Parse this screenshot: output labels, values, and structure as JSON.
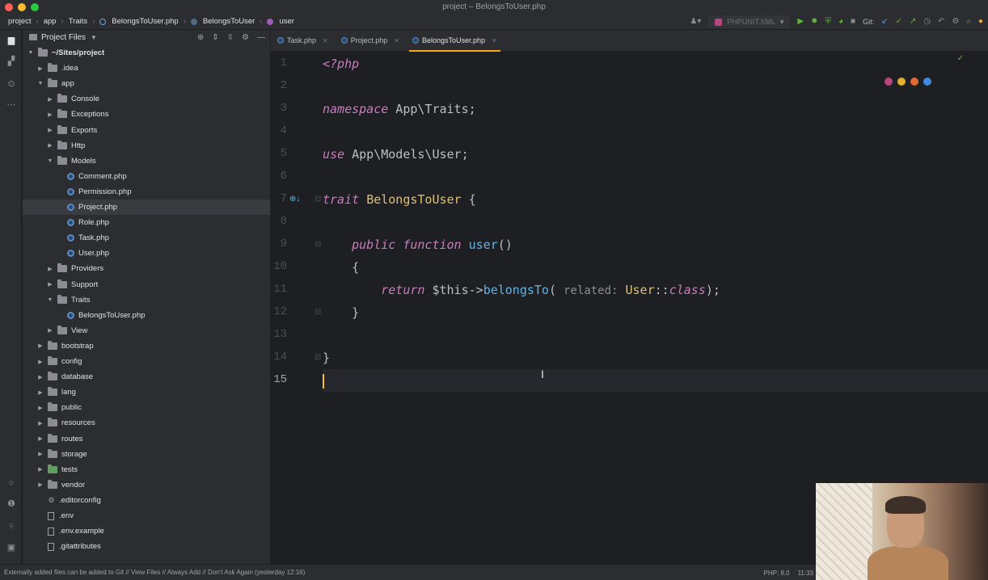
{
  "window": {
    "title": "project – BelongsToUser.php"
  },
  "breadcrumb": {
    "items": [
      "project",
      "app",
      "Traits",
      "BelongsToUser.php",
      "BelongsToUser",
      "user"
    ]
  },
  "toolbar": {
    "run_config": "PHPUNIT.XML",
    "git_label": "Git:"
  },
  "project_panel": {
    "title": "Project Files",
    "tree": [
      {
        "label": "~/Sites/project",
        "type": "folder",
        "depth": 0,
        "expanded": true
      },
      {
        "label": ".idea",
        "type": "folder",
        "depth": 1,
        "expanded": false
      },
      {
        "label": "app",
        "type": "folder",
        "depth": 1,
        "expanded": true
      },
      {
        "label": "Console",
        "type": "folder",
        "depth": 2,
        "expanded": false
      },
      {
        "label": "Exceptions",
        "type": "folder",
        "depth": 2,
        "expanded": false
      },
      {
        "label": "Exports",
        "type": "folder",
        "depth": 2,
        "expanded": false
      },
      {
        "label": "Http",
        "type": "folder",
        "depth": 2,
        "expanded": false
      },
      {
        "label": "Models",
        "type": "folder",
        "depth": 2,
        "expanded": true
      },
      {
        "label": "Comment.php",
        "type": "php",
        "depth": 3
      },
      {
        "label": "Permission.php",
        "type": "php",
        "depth": 3
      },
      {
        "label": "Project.php",
        "type": "php",
        "depth": 3,
        "selected": true
      },
      {
        "label": "Role.php",
        "type": "php",
        "depth": 3
      },
      {
        "label": "Task.php",
        "type": "php",
        "depth": 3
      },
      {
        "label": "User.php",
        "type": "php",
        "depth": 3
      },
      {
        "label": "Providers",
        "type": "folder",
        "depth": 2,
        "expanded": false
      },
      {
        "label": "Support",
        "type": "folder",
        "depth": 2,
        "expanded": false
      },
      {
        "label": "Traits",
        "type": "folder",
        "depth": 2,
        "expanded": true
      },
      {
        "label": "BelongsToUser.php",
        "type": "php",
        "depth": 3
      },
      {
        "label": "View",
        "type": "folder",
        "depth": 2,
        "expanded": false
      },
      {
        "label": "bootstrap",
        "type": "folder",
        "depth": 1,
        "expanded": false
      },
      {
        "label": "config",
        "type": "folder",
        "depth": 1,
        "expanded": false
      },
      {
        "label": "database",
        "type": "folder",
        "depth": 1,
        "expanded": false
      },
      {
        "label": "lang",
        "type": "folder",
        "depth": 1,
        "expanded": false
      },
      {
        "label": "public",
        "type": "folder",
        "depth": 1,
        "expanded": false
      },
      {
        "label": "resources",
        "type": "folder",
        "depth": 1,
        "expanded": false
      },
      {
        "label": "routes",
        "type": "folder",
        "depth": 1,
        "expanded": false
      },
      {
        "label": "storage",
        "type": "folder",
        "depth": 1,
        "expanded": false
      },
      {
        "label": "tests",
        "type": "folder-green",
        "depth": 1,
        "expanded": false
      },
      {
        "label": "vendor",
        "type": "folder",
        "depth": 1,
        "expanded": false
      },
      {
        "label": ".editorconfig",
        "type": "config",
        "depth": 1
      },
      {
        "label": ".env",
        "type": "text",
        "depth": 1
      },
      {
        "label": ".env.example",
        "type": "text",
        "depth": 1
      },
      {
        "label": ".gitattributes",
        "type": "text",
        "depth": 1
      }
    ]
  },
  "tabs": [
    {
      "label": "Task.php",
      "active": false
    },
    {
      "label": "Project.php",
      "active": false
    },
    {
      "label": "BelongsToUser.php",
      "active": true
    }
  ],
  "editor": {
    "line_numbers": [
      "1",
      "2",
      "3",
      "4",
      "5",
      "6",
      "7",
      "8",
      "9",
      "10",
      "11",
      "12",
      "13",
      "14",
      "15"
    ],
    "current_line": 15,
    "lines": [
      {
        "tokens": [
          {
            "t": "<?php",
            "c": "php-tag"
          }
        ]
      },
      {
        "tokens": []
      },
      {
        "tokens": [
          {
            "t": "namespace",
            "c": "kw-italic"
          },
          {
            "t": " App\\Traits;",
            "c": "cls"
          }
        ]
      },
      {
        "tokens": []
      },
      {
        "tokens": [
          {
            "t": "use",
            "c": "kw-italic"
          },
          {
            "t": " App\\Models\\User;",
            "c": "cls"
          }
        ]
      },
      {
        "tokens": []
      },
      {
        "tokens": [
          {
            "t": "trait",
            "c": "kw-italic"
          },
          {
            "t": " ",
            "c": "cls"
          },
          {
            "t": "BelongsToUser",
            "c": "trait-name"
          },
          {
            "t": " {",
            "c": "cls"
          }
        ]
      },
      {
        "tokens": []
      },
      {
        "tokens": [
          {
            "t": "    ",
            "c": "cls"
          },
          {
            "t": "public",
            "c": "kw-italic"
          },
          {
            "t": " ",
            "c": "cls"
          },
          {
            "t": "function",
            "c": "kw-italic"
          },
          {
            "t": " ",
            "c": "cls"
          },
          {
            "t": "user",
            "c": "func-name"
          },
          {
            "t": "()",
            "c": "cls"
          }
        ]
      },
      {
        "tokens": [
          {
            "t": "    {",
            "c": "cls"
          }
        ]
      },
      {
        "tokens": [
          {
            "t": "        ",
            "c": "cls"
          },
          {
            "t": "return",
            "c": "kw-italic"
          },
          {
            "t": " $this->",
            "c": "cls"
          },
          {
            "t": "belongsTo",
            "c": "method-call"
          },
          {
            "t": "( ",
            "c": "cls"
          },
          {
            "t": "related:",
            "c": "hint"
          },
          {
            "t": " ",
            "c": "cls"
          },
          {
            "t": "User",
            "c": "static-cls"
          },
          {
            "t": "::",
            "c": "cls"
          },
          {
            "t": "class",
            "c": "const-class"
          },
          {
            "t": ");",
            "c": "cls"
          }
        ]
      },
      {
        "tokens": [
          {
            "t": "    }",
            "c": "cls"
          }
        ]
      },
      {
        "tokens": []
      },
      {
        "tokens": [
          {
            "t": "}",
            "c": "cls"
          }
        ]
      },
      {
        "tokens": []
      }
    ]
  },
  "statusbar": {
    "message": "Externally added files can be added to Git // View Files // Always Add // Don't Ask Again (yesterday 12:16)",
    "php_version": "PHP: 8.0",
    "time": "11:33"
  },
  "colors": {
    "accent_tab": "#f5a623",
    "keyword": "#c77dbb",
    "function": "#5fb5e8",
    "class_name": "#e0c074"
  }
}
